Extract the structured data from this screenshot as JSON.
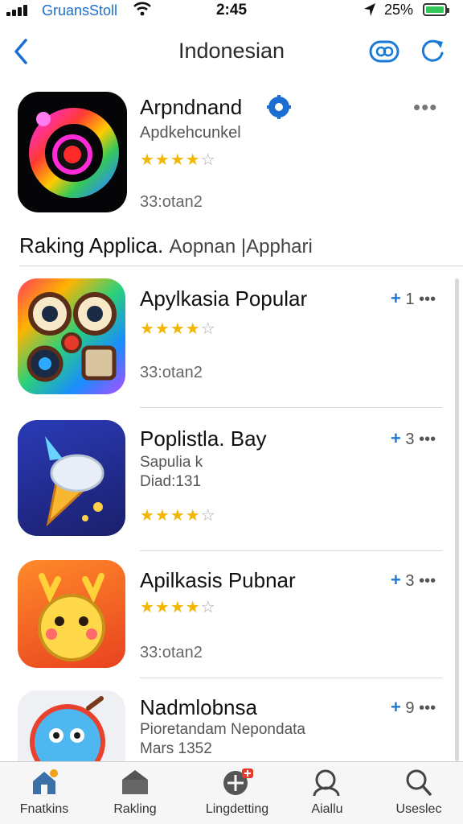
{
  "status_bar": {
    "carrier": "GruansStoll",
    "time": "2:45",
    "battery": "25%"
  },
  "header": {
    "title": "Indonesian"
  },
  "featured": {
    "name": "Arpndnand",
    "developer": "Apdkehcunkel",
    "stars": 4,
    "count": "33:otan2"
  },
  "section": {
    "title": "Raking Applica.",
    "subtitle": "Aopnan |Apphari"
  },
  "apps": [
    {
      "name": "Apylkasia Popular",
      "line1": "",
      "line2": "",
      "count": "33:otan2",
      "rank": "1",
      "stars": 4
    },
    {
      "name": "Poplistla. Bay",
      "line1": "Sapulia k",
      "line2": "Diad:131",
      "count": "",
      "rank": "3",
      "stars": 4
    },
    {
      "name": "Apilkasis Pubnar",
      "line1": "",
      "line2": "",
      "count": "33:otan2",
      "rank": "3",
      "stars": 4
    },
    {
      "name": "Nadmlobnsa",
      "line1": "Pioretandam Nepondata",
      "line2": "Mars 1352",
      "count": "",
      "rank": "9",
      "stars": 0
    }
  ],
  "tabbar": {
    "tabs": [
      {
        "label": "Fnatkins",
        "icon": "home-icon"
      },
      {
        "label": "Rakling",
        "icon": "ranking-icon"
      },
      {
        "label": "Lingdetting",
        "icon": "games-icon"
      },
      {
        "label": "Aiallu",
        "icon": "apps-search-icon"
      },
      {
        "label": "Useslec",
        "icon": "search-icon"
      }
    ]
  },
  "colors": {
    "accent": "#1a7ad8",
    "star": "#f2b705",
    "battery": "#34c759"
  }
}
